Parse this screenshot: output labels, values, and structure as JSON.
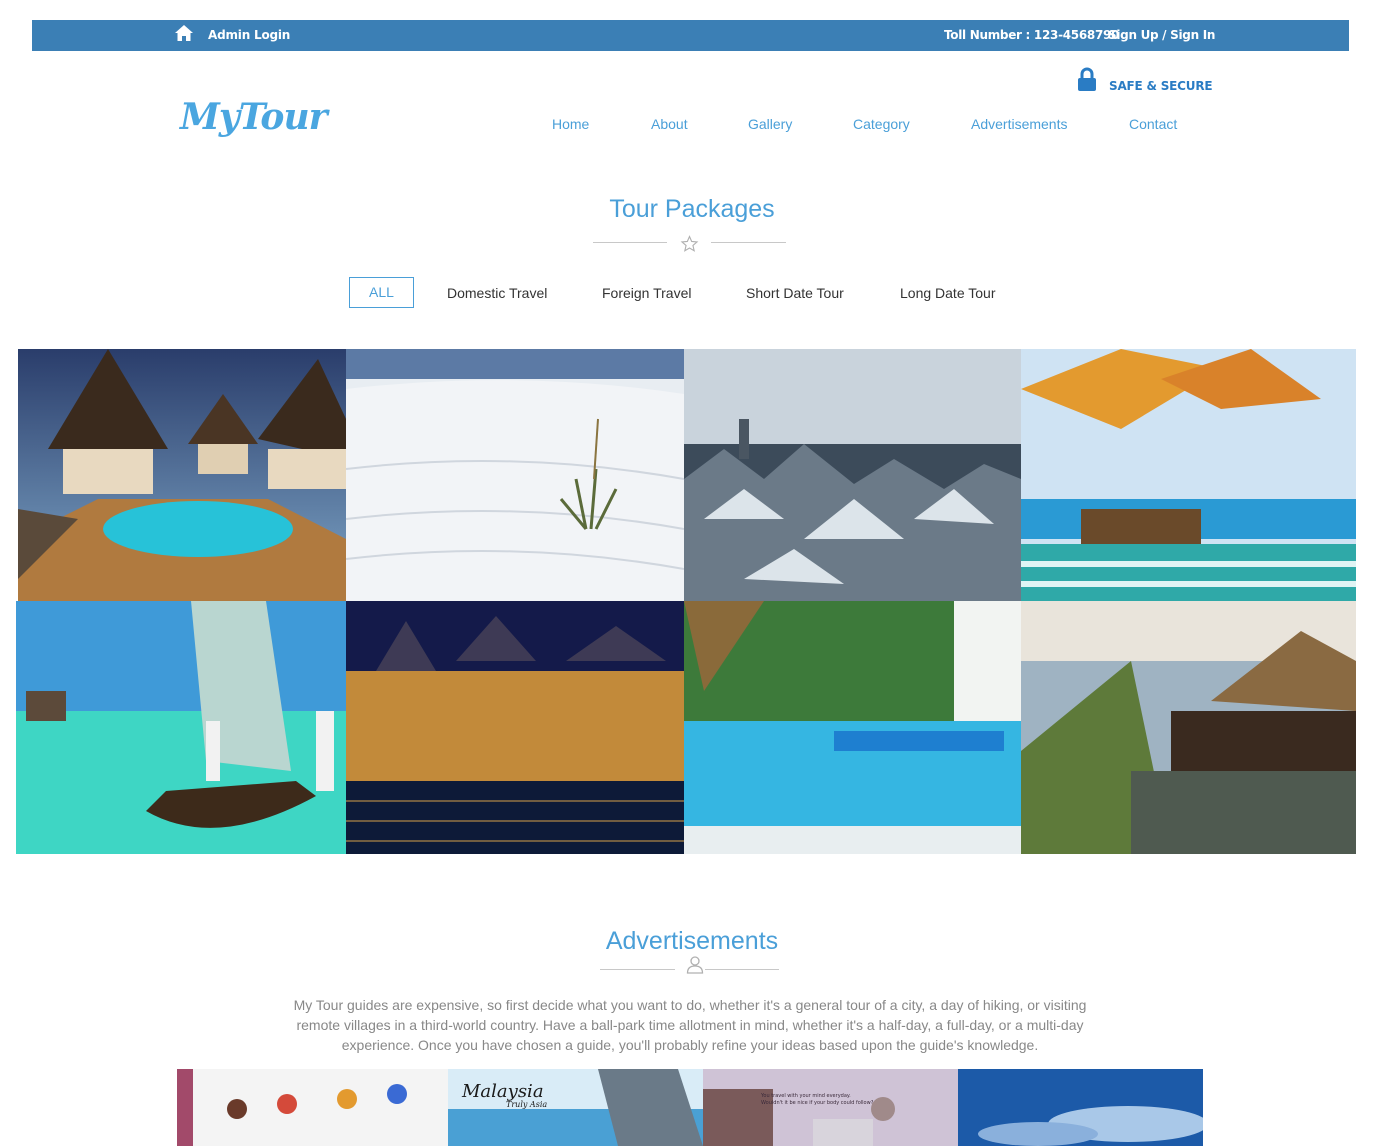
{
  "topbar": {
    "admin_login": "Admin Login",
    "toll_number": "Toll Number : 123-4568790",
    "signup": "Sign Up / Sign In",
    "background": "#3b7fb5"
  },
  "header": {
    "safe_secure": "SAFE & SECURE",
    "logo": "MyTour"
  },
  "nav": {
    "items": [
      "Home",
      "About",
      "Gallery",
      "Category",
      "Advertisements",
      "Contact"
    ]
  },
  "tour_packages": {
    "title": "Tour Packages",
    "filters": [
      "ALL",
      "Domestic Travel",
      "Foreign Travel",
      "Short Date Tour",
      "Long Date Tour"
    ],
    "active_filter": "ALL",
    "images": [
      "Overwater villas with pool",
      "White sand dunes with yucca",
      "Snowy rooftops of old city",
      "Poolside umbrellas and loungers",
      "Sailboat on turquoise lagoon",
      "Illuminated palace by river",
      "Resort pool with palms",
      "Cliffside restaurant over sea"
    ]
  },
  "advertisements": {
    "title": "Advertisements",
    "description": "My Tour guides are expensive, so first decide what you want to do, whether it's a general tour of a city, a day of hiking, or visiting remote villages in a third-world country. Have a ball-park time allotment in mind, whether it's a half-day, a full-day, or a multi-day experience. Once you have chosen a guide, you'll probably refine your ideas based upon the guide's knowledge.",
    "ad_images": [
      "Group jumping on beach",
      "Malaysia Truly Asia climbers",
      "Venice city view",
      "Blue sky and clouds"
    ],
    "ad_caption_malaysia": "Malaysia",
    "ad_caption_truly_asia": "Truly Asia",
    "ad_caption_travel_1": "You travel with your mind everyday.",
    "ad_caption_travel_2": "Wouldn't it be nice if your body could follow?"
  },
  "colors": {
    "accent": "#4a9fd8",
    "topbar": "#3b7fb5"
  }
}
